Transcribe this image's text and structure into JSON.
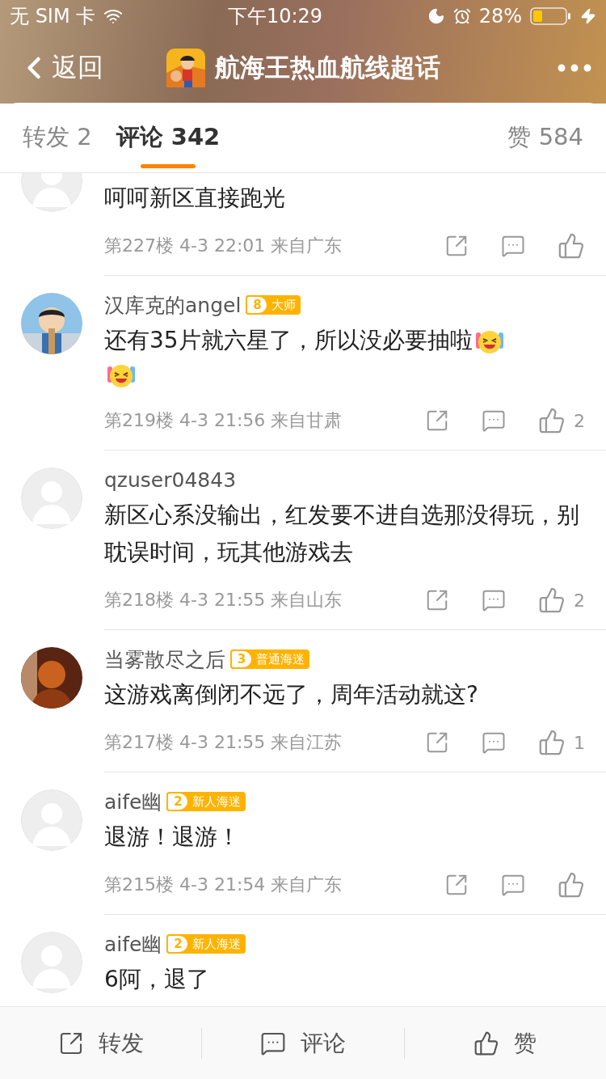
{
  "status_bar": {
    "carrier": "无 SIM 卡",
    "time": "下午10:29",
    "battery": "28%"
  },
  "nav": {
    "back": "返回",
    "title": "航海王热血航线超话"
  },
  "tabs": [
    {
      "label": "转发 2",
      "selected": false
    },
    {
      "label": "评论 342",
      "selected": true
    }
  ],
  "likes_tab": "赞 584",
  "comments": [
    {
      "avatar": {
        "kind": "default"
      },
      "text": "呵呵新区直接跑光",
      "meta": "第227楼 4-3 22:01 来自广东"
    },
    {
      "avatar": {
        "kind": "picture"
      },
      "name": "汉库克的angel",
      "badge": {
        "rank": "8",
        "title": "大师",
        "color": "#ffb300"
      },
      "text": "还有35片就六星了，所以没必要抽啦",
      "emojis": [
        {
          "kind": "laughing"
        },
        {
          "kind": "laughing"
        }
      ],
      "meta": "第219楼 4-3 21:56 来自甘肃",
      "likes": "2"
    },
    {
      "avatar": {
        "kind": "default"
      },
      "name": "qzuser04843",
      "text": "新区心系没输出，红发要不进自选那没得玩，别耽误时间，玩其他游戏去",
      "meta": "第218楼 4-3 21:55 来自山东",
      "likes": "2"
    },
    {
      "avatar": {
        "kind": "figure"
      },
      "name": "当雾散尽之后",
      "badge": {
        "rank": "3",
        "title": "普通海迷",
        "color": "#ffb300"
      },
      "text": "这游戏离倒闭不远了，周年活动就这?",
      "meta": "第217楼 4-3 21:55 来自江苏",
      "likes": "1"
    },
    {
      "avatar": {
        "kind": "default"
      },
      "name": "aife幽",
      "badge": {
        "rank": "2",
        "title": "新人海迷",
        "color": "#ffb300"
      },
      "text": "退游！退游！",
      "meta": "第215楼 4-3 21:54 来自广东"
    },
    {
      "avatar": {
        "kind": "default"
      },
      "name": "aife幽",
      "badge": {
        "rank": "2",
        "title": "新人海迷",
        "color": "#ffb300"
      },
      "text": "6阿，退了"
    }
  ],
  "bottom_bar": [
    {
      "kind": "share",
      "label": "转发"
    },
    {
      "kind": "comment",
      "label": "评论"
    },
    {
      "kind": "like",
      "label": "赞"
    }
  ]
}
